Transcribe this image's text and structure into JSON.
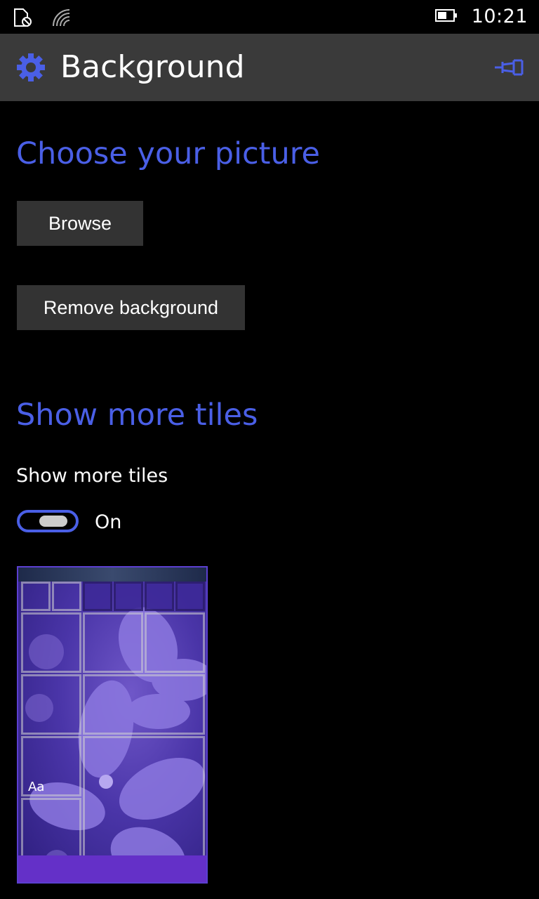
{
  "status_bar": {
    "time": "10:21",
    "icons": [
      "sim-blocked-icon",
      "wifi-icon",
      "battery-icon"
    ]
  },
  "header": {
    "title": "Background",
    "icon": "gear-icon",
    "pin_icon": "pin-icon",
    "accent_color": "#4a5fe6"
  },
  "sections": {
    "choose_picture": {
      "heading": "Choose your picture",
      "browse_label": "Browse",
      "remove_label": "Remove background"
    },
    "more_tiles": {
      "heading": "Show more tiles",
      "toggle_label": "Show more tiles",
      "toggle_state": "On",
      "toggle_on": true
    }
  },
  "preview": {
    "sample_text": "Aa",
    "accent_color": "#6430c8"
  }
}
